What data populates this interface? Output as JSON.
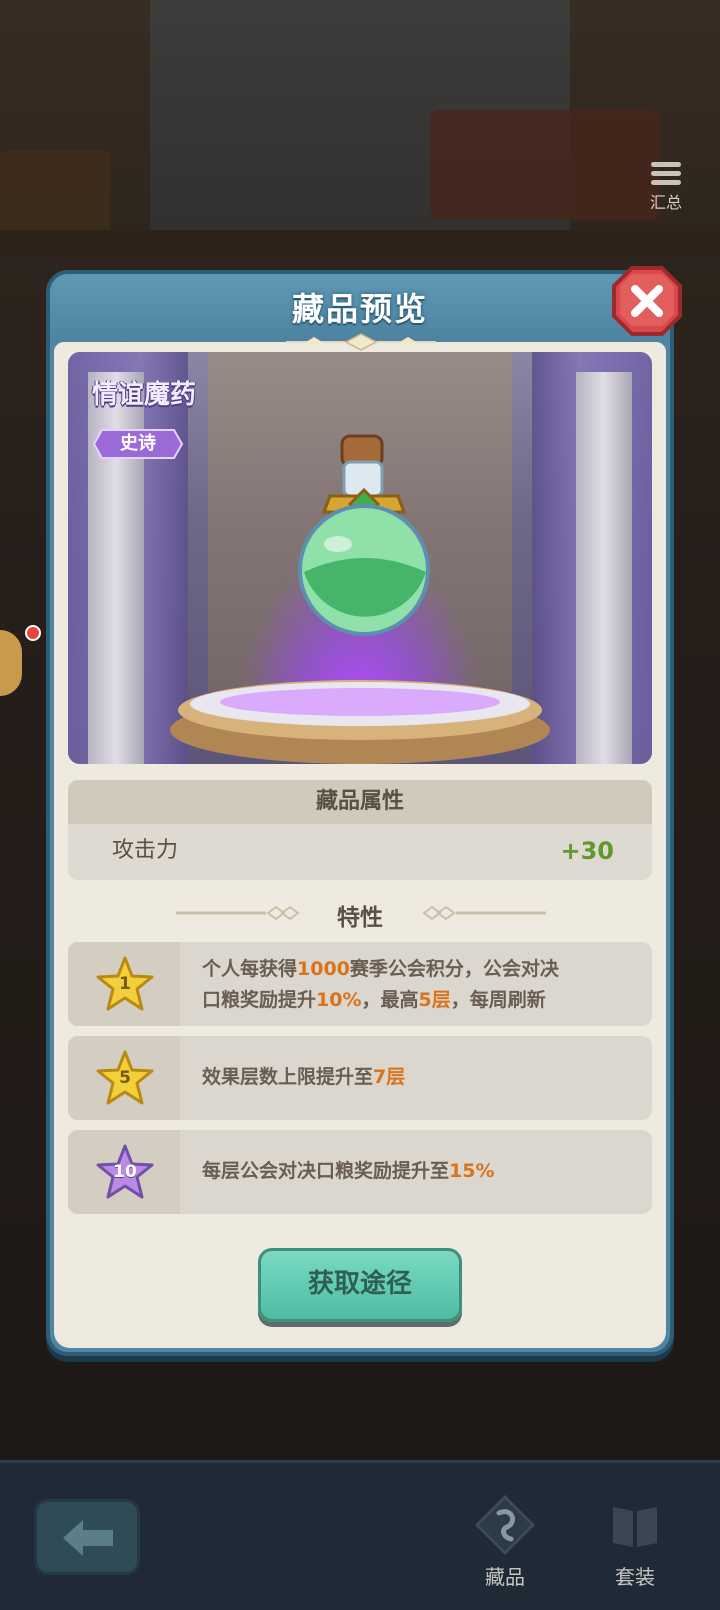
{
  "background": {
    "summary_label": "汇总"
  },
  "modal": {
    "title": "藏品预览",
    "item": {
      "name": "情谊魔药",
      "rarity": "史诗"
    },
    "attributes": {
      "header": "藏品属性",
      "rows": [
        {
          "name": "攻击力",
          "value": "+30"
        }
      ]
    },
    "traits": {
      "header": "特性",
      "items": [
        {
          "level": "1",
          "star_color": "gold",
          "segments": [
            "个人每获得",
            "1000",
            "赛季公会积分，公会对决",
            "口粮奖励提升",
            "10%",
            "，最高",
            "5层",
            "，每周刷新"
          ]
        },
        {
          "level": "5",
          "star_color": "gold",
          "segments": [
            "效果层数上限提升至",
            "7层"
          ]
        },
        {
          "level": "10",
          "star_color": "purple",
          "segments": [
            "每层公会对决口粮奖励提升至",
            "15%"
          ]
        }
      ]
    },
    "action_button": "获取途径"
  },
  "bottom_nav": {
    "tabs": [
      {
        "label": "藏品",
        "icon": "collection-icon"
      },
      {
        "label": "套装",
        "icon": "set-book-icon"
      }
    ]
  },
  "colors": {
    "highlight": "#d9731c",
    "attr_value": "#5e9a2c",
    "modal_frame": "#4f86a3",
    "action_button": "#4fbda3",
    "epic_purple": "#9b6ad6"
  }
}
